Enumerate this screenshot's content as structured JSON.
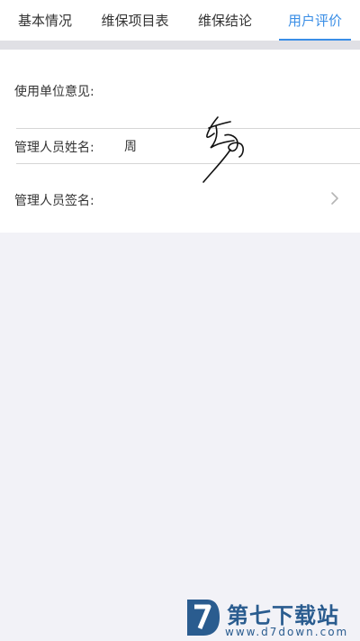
{
  "tabs": [
    {
      "label": "基本情况",
      "active": false
    },
    {
      "label": "维保项目表",
      "active": false
    },
    {
      "label": "维保结论",
      "active": false
    },
    {
      "label": "用户评价",
      "active": true
    }
  ],
  "form": {
    "opinion_label": "使用单位意见:",
    "opinion_value": "",
    "manager_name_label": "管理人员姓名:",
    "manager_name_value": "周",
    "manager_sign_label": "管理人员签名:"
  },
  "watermark": {
    "title": "第七下载站",
    "url": "www.d7down.com"
  },
  "colors": {
    "accent": "#3a8ee6",
    "background": "#f2f2f7",
    "watermark": "#2a5c8f"
  },
  "icons": {
    "row_chevron": "chevron-right-icon",
    "watermark_logo": "d7-logo-icon"
  }
}
